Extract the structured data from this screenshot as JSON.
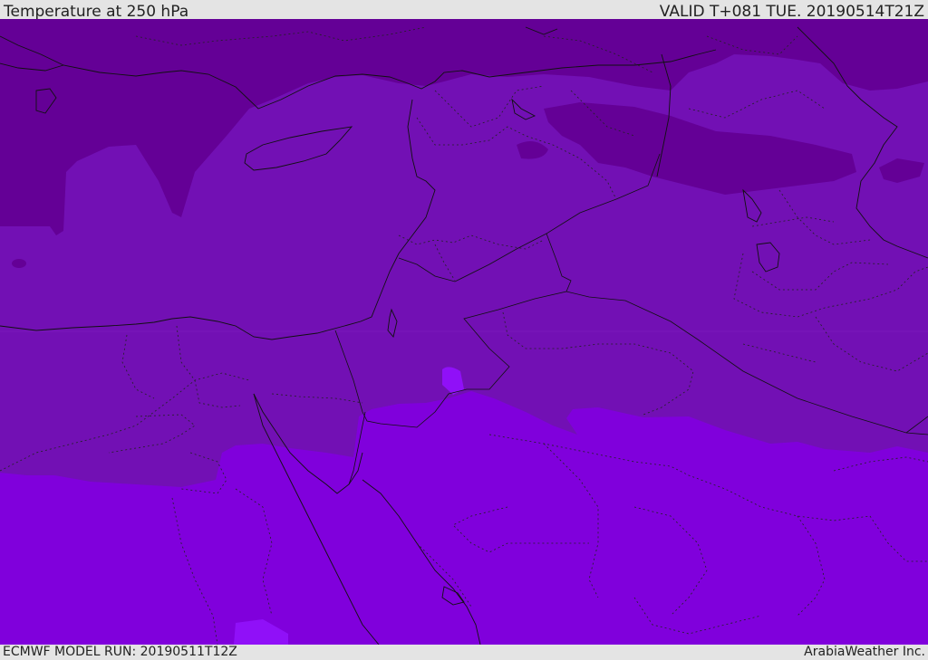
{
  "header": {
    "title": "Temperature at 250 hPa",
    "valid": "VALID T+081 TUE. 20190514T21Z"
  },
  "footer": {
    "model_run": "ECMWF MODEL RUN: 20190511T12Z",
    "credit": "ArabiaWeather Inc."
  },
  "colors": {
    "coldest": "#640096",
    "cold": "#7210b4",
    "mild": "#8000dc",
    "warm": "#9010f8",
    "borders": "#111111"
  }
}
